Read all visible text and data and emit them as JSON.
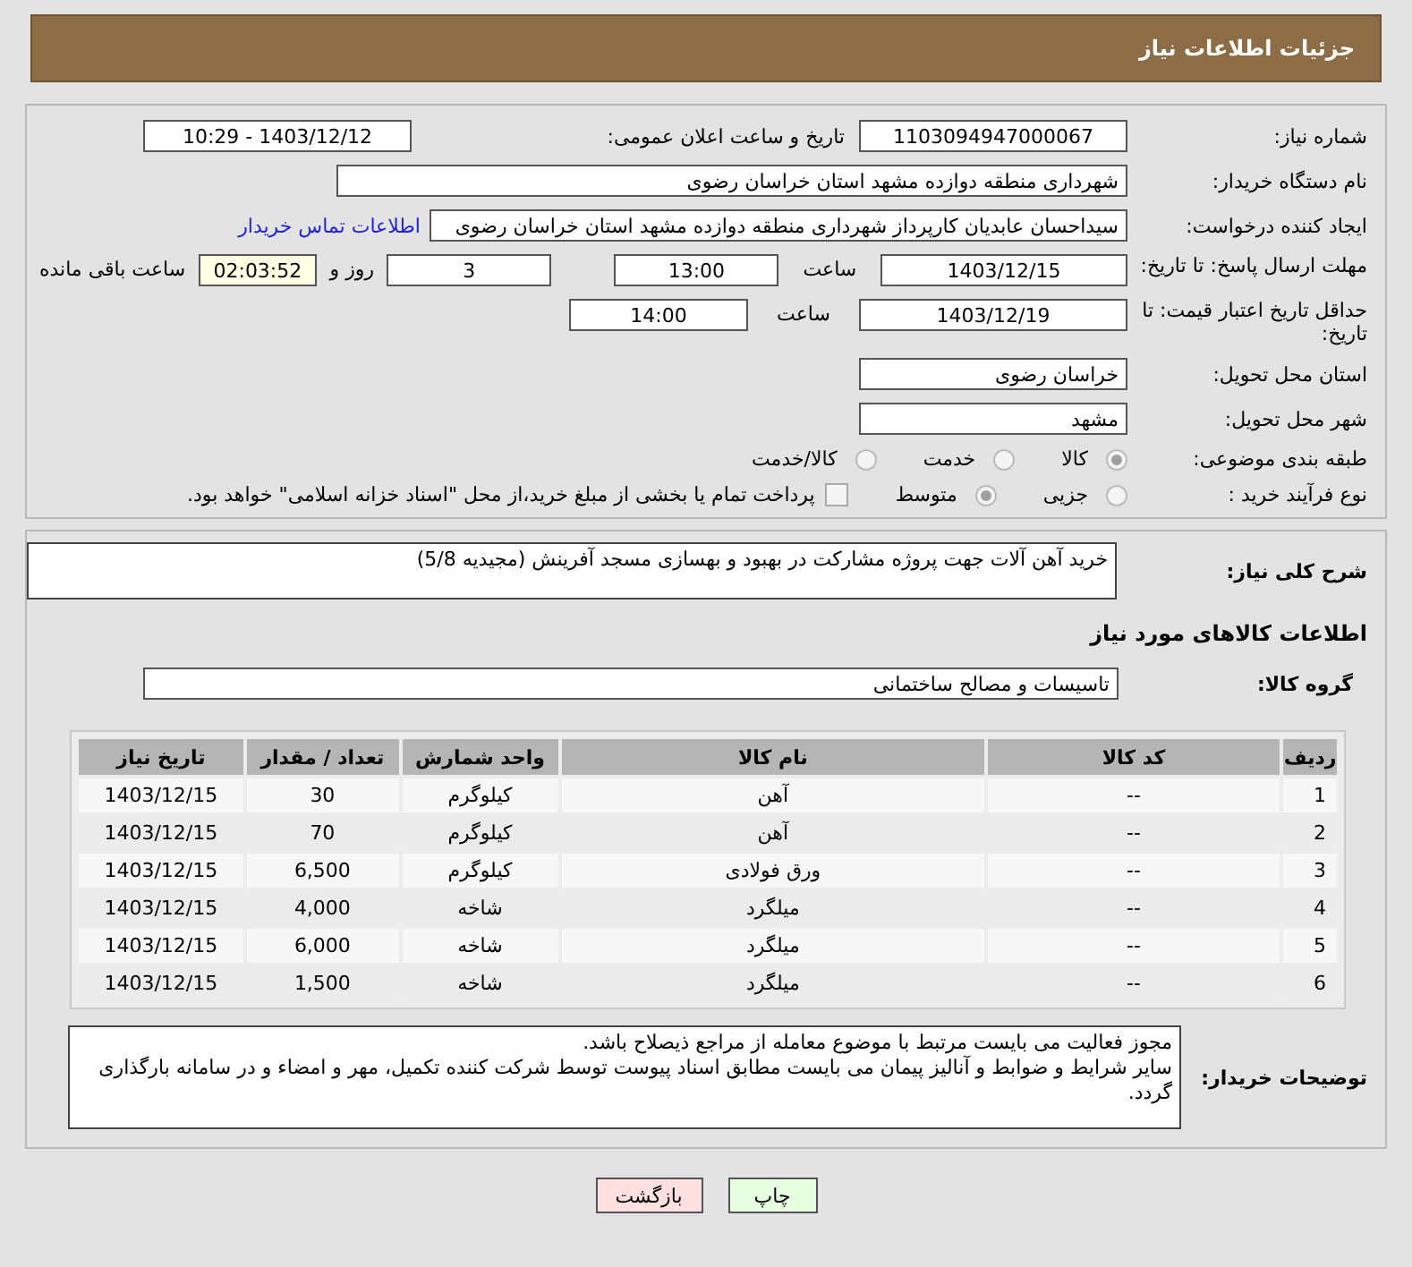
{
  "header_title": "جزئیات اطلاعات نیاز",
  "need_number": {
    "label": "شماره نیاز:",
    "value": "1103094947000067"
  },
  "announce": {
    "label": "تاریخ و ساعت اعلان عمومی:",
    "value": "1403/12/12 - 10:29"
  },
  "buyer_org": {
    "label": "نام دستگاه خریدار:",
    "value": "شهرداری منطقه دوازده مشهد استان خراسان رضوی"
  },
  "requester": {
    "label": "ایجاد کننده درخواست:",
    "value": "سیداحسان عابدیان کارپرداز شهرداری منطقه دوازده مشهد استان خراسان رضوی",
    "link": "اطلاعات تماس خریدار"
  },
  "response_deadline": {
    "label": "مهلت ارسال پاسخ: تا تاریخ:",
    "date": "1403/12/15",
    "time_label": "ساعت",
    "time": "13:00",
    "days": "3",
    "days_label": "روز و",
    "remaining": "02:03:52",
    "remaining_label": "ساعت باقی مانده"
  },
  "price_validity": {
    "label": "حداقل تاریخ اعتبار قیمت: تا تاریخ:",
    "date": "1403/12/19",
    "time_label": "ساعت",
    "time": "14:00"
  },
  "province": {
    "label": "استان محل تحویل:",
    "value": "خراسان رضوی"
  },
  "city": {
    "label": "شهر محل تحویل:",
    "value": "مشهد"
  },
  "category": {
    "label": "طبقه بندی موضوعی:",
    "options": [
      {
        "label": "کالا",
        "selected": true
      },
      {
        "label": "خدمت",
        "selected": false
      },
      {
        "label": "کالا/خدمت",
        "selected": false
      }
    ]
  },
  "purchase_process": {
    "label": "نوع فرآیند خرید :",
    "options": [
      {
        "label": "جزیی",
        "selected": false
      },
      {
        "label": "متوسط",
        "selected": true
      }
    ],
    "note": {
      "checked": false,
      "text": "پرداخت تمام یا بخشی از مبلغ خرید،از محل \"اسناد خزانه اسلامی\" خواهد بود."
    }
  },
  "description": {
    "label": "شرح کلی نیاز:",
    "value": "خرید آهن آلات جهت پروژه مشارکت در بهبود و بهسازی مسجد آفرینش (مجیدیه 5/8)"
  },
  "goods_section_title": "اطلاعات کالاهای مورد نیاز",
  "goods_group": {
    "label": "گروه کالا:",
    "value": "تاسیسات و مصالح ساختمانی"
  },
  "table": {
    "columns": [
      "ردیف",
      "کد کالا",
      "نام کالا",
      "واحد شمارش",
      "تعداد / مقدار",
      "تاریخ نیاز"
    ],
    "rows": [
      [
        "1",
        "--",
        "آهن",
        "کیلوگرم",
        "30",
        "1403/12/15"
      ],
      [
        "2",
        "--",
        "آهن",
        "کیلوگرم",
        "70",
        "1403/12/15"
      ],
      [
        "3",
        "--",
        "ورق فولادی",
        "کیلوگرم",
        "6,500",
        "1403/12/15"
      ],
      [
        "4",
        "--",
        "میلگرد",
        "شاخه",
        "4,000",
        "1403/12/15"
      ],
      [
        "5",
        "--",
        "میلگرد",
        "شاخه",
        "6,000",
        "1403/12/15"
      ],
      [
        "6",
        "--",
        "میلگرد",
        "شاخه",
        "1,500",
        "1403/12/15"
      ]
    ]
  },
  "buyer_notes": {
    "label": "توضیحات خریدار:",
    "value": "مجوز فعالیت می بایست مرتبط با موضوع معامله از مراجع ذیصلاح باشد.\nسایر شرایط و ضوابط و آنالیز پیمان می بایست مطابق اسناد پیوست توسط شرکت کننده تکمیل، مهر و امضاء و در سامانه بارگذاری گردد."
  },
  "buttons": [
    {
      "label": "چاپ",
      "kind": "print"
    },
    {
      "label": "بازگشت",
      "kind": "back"
    }
  ]
}
